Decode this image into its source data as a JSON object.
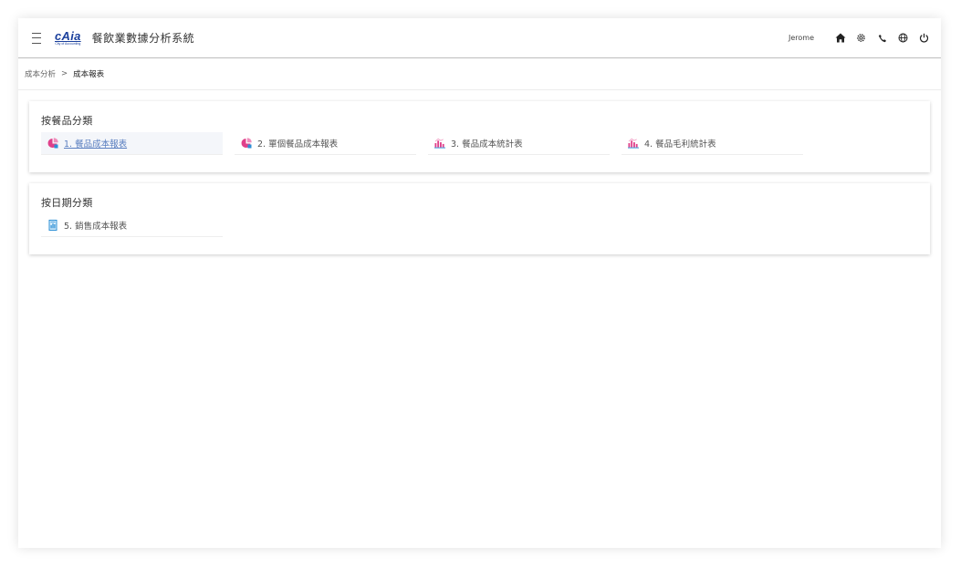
{
  "header": {
    "logo_text": "cAia",
    "logo_subtext": "City of Accounting",
    "app_title": "餐飲業數據分析系統",
    "username": "Jerome",
    "icons": [
      "home-icon",
      "gear-icon",
      "phone-icon",
      "globe-icon",
      "power-icon"
    ]
  },
  "breadcrumb": {
    "parent": "成本分析",
    "separator": ">",
    "current": "成本報表"
  },
  "sections": [
    {
      "title": "按餐品分類",
      "items": [
        {
          "label": "1. 餐品成本報表",
          "icon": "pie-chart-icon",
          "active": true
        },
        {
          "label": "2. 單個餐品成本報表",
          "icon": "pie-chart-icon",
          "active": false
        },
        {
          "label": "3. 餐品成本統計表",
          "icon": "bar-chart-icon",
          "active": false
        },
        {
          "label": "4. 餐品毛利統計表",
          "icon": "bar-chart-icon",
          "active": false
        }
      ]
    },
    {
      "title": "按日期分類",
      "items": [
        {
          "label": "5. 銷售成本報表",
          "icon": "document-chart-icon",
          "active": false
        }
      ]
    }
  ],
  "colors": {
    "brand": "#1a3f9c",
    "icon_pink": "#e0408a",
    "icon_blue": "#2b8fd6",
    "active_link": "#5a7fc0"
  }
}
